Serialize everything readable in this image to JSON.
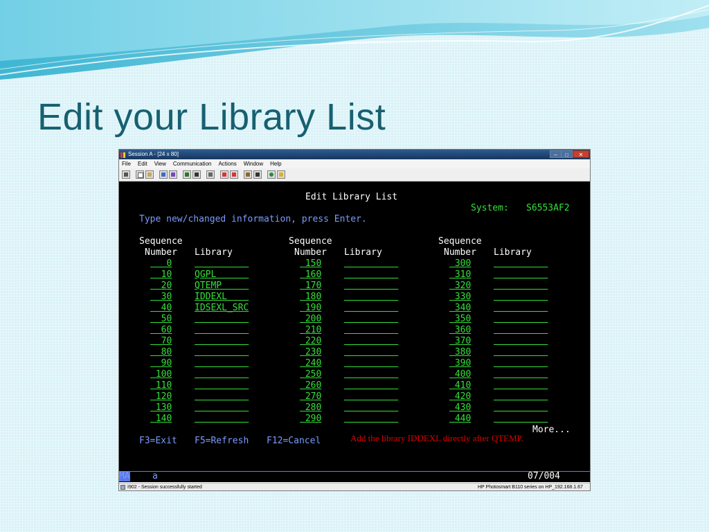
{
  "slide": {
    "title": "Edit your Library List"
  },
  "window": {
    "title": "Session A - [24 x 80]",
    "menu": [
      "File",
      "Edit",
      "View",
      "Communication",
      "Actions",
      "Window",
      "Help"
    ],
    "toolbar_icons": [
      "print-icon",
      "copy-icon",
      "paste-icon",
      "send-icon",
      "receive-icon",
      "display-icon",
      "keyboard-icon",
      "macro-icon",
      "record-icon",
      "play-icon",
      "transfer-icon",
      "download-icon",
      "globe-icon",
      "edit-icon"
    ]
  },
  "terminal": {
    "header": "Edit Library List",
    "system_label": "System:",
    "system_name": "S6553AF2",
    "instruction": "Type new/changed information, press Enter.",
    "col_header_seq_1": "Sequence",
    "col_header_seq_2": "Number",
    "col_header_lib": "Library",
    "rows": [
      {
        "c1": "0",
        "l1": "",
        "c2": "150",
        "l2": "",
        "c3": "300",
        "l3": ""
      },
      {
        "c1": "10",
        "l1": "QGPL",
        "c2": "160",
        "l2": "",
        "c3": "310",
        "l3": ""
      },
      {
        "c1": "20",
        "l1": "QTEMP",
        "c2": "170",
        "l2": "",
        "c3": "320",
        "l3": ""
      },
      {
        "c1": "30",
        "l1": "IDDEXL",
        "c2": "180",
        "l2": "",
        "c3": "330",
        "l3": ""
      },
      {
        "c1": "40",
        "l1": "IDSEXL_SRC",
        "c2": "190",
        "l2": "",
        "c3": "340",
        "l3": ""
      },
      {
        "c1": "50",
        "l1": "",
        "c2": "200",
        "l2": "",
        "c3": "350",
        "l3": ""
      },
      {
        "c1": "60",
        "l1": "",
        "c2": "210",
        "l2": "",
        "c3": "360",
        "l3": ""
      },
      {
        "c1": "70",
        "l1": "",
        "c2": "220",
        "l2": "",
        "c3": "370",
        "l3": ""
      },
      {
        "c1": "80",
        "l1": "",
        "c2": "230",
        "l2": "",
        "c3": "380",
        "l3": ""
      },
      {
        "c1": "90",
        "l1": "",
        "c2": "240",
        "l2": "",
        "c3": "390",
        "l3": ""
      },
      {
        "c1": "100",
        "l1": "",
        "c2": "250",
        "l2": "",
        "c3": "400",
        "l3": ""
      },
      {
        "c1": "110",
        "l1": "",
        "c2": "260",
        "l2": "",
        "c3": "410",
        "l3": ""
      },
      {
        "c1": "120",
        "l1": "",
        "c2": "270",
        "l2": "",
        "c3": "420",
        "l3": ""
      },
      {
        "c1": "130",
        "l1": "",
        "c2": "280",
        "l2": "",
        "c3": "430",
        "l3": ""
      },
      {
        "c1": "140",
        "l1": "",
        "c2": "290",
        "l2": "",
        "c3": "440",
        "l3": ""
      }
    ],
    "more": "More...",
    "fkey_exit": "F3=Exit",
    "fkey_refresh": "F5=Refresh",
    "fkey_cancel": "F12=Cancel",
    "oia_mode": "MA",
    "oia_shift": "a",
    "oia_cursor": "07/004"
  },
  "annotation": "Add the library IDDEXL directly after QTEMP.",
  "statusbar": {
    "message": "I902 - Session successfully started",
    "printer": "HP Photosmart B110 series on HP_192.168.1.67"
  },
  "colors": {
    "title": "#17606f",
    "terminal_green": "#36e03a",
    "terminal_blue": "#7b9cff",
    "annotation_red": "#e00000"
  }
}
